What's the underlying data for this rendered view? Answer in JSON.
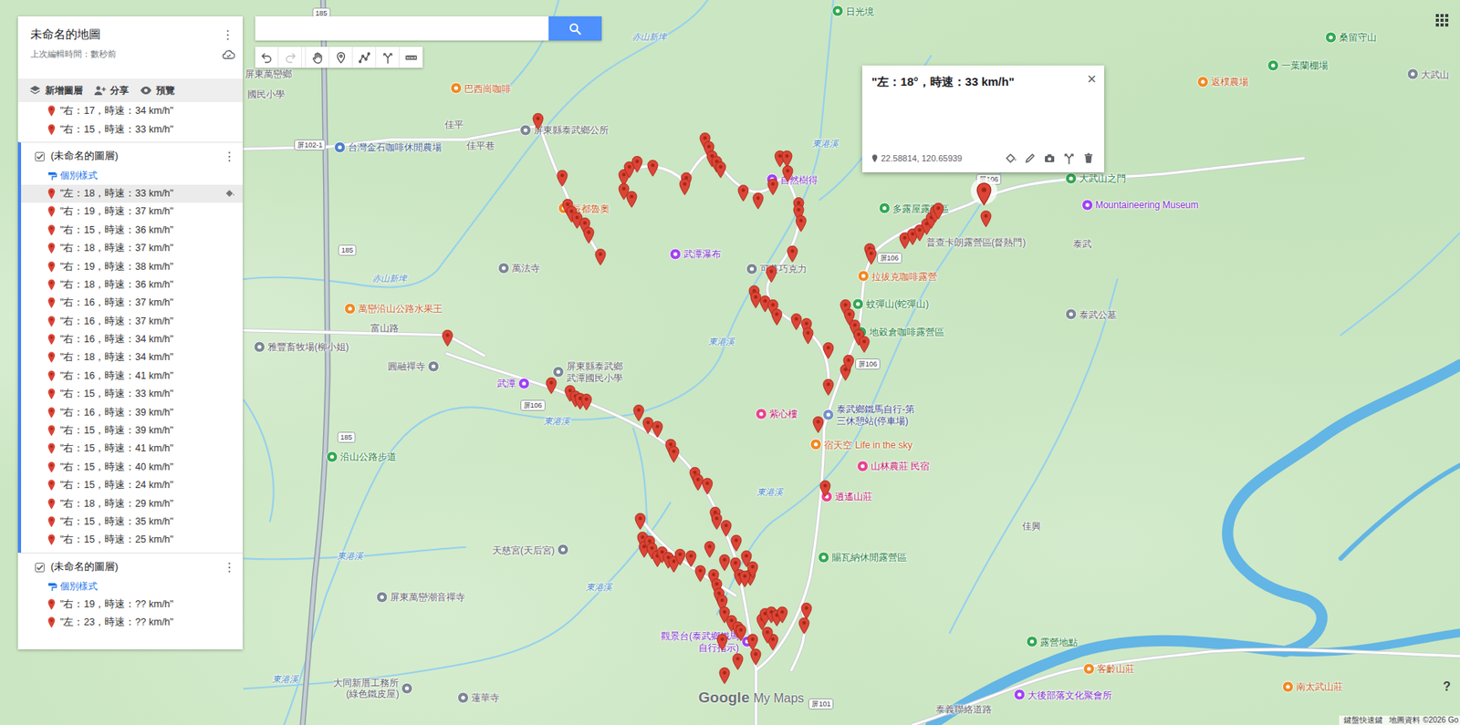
{
  "panel": {
    "title": "未命名的地圖",
    "subtitle": "上次編輯時間：數秒前",
    "menu": "⋮",
    "actions": [
      {
        "label": "新增圖層"
      },
      {
        "label": "分享"
      },
      {
        "label": "預覽"
      }
    ],
    "groups": [
      {
        "items": [
          {
            "label": "\"右：17，時速：34 km/h\"",
            "selected": false
          },
          {
            "label": "\"右：15，時速：33 km/h\"",
            "selected": false
          }
        ]
      },
      {
        "name": "(未命名的圖層)",
        "checked": true,
        "active": true,
        "menu": "⋮",
        "style_label": "個別樣式",
        "items": [
          {
            "label": "\"左：18，時速：33 km/h\"",
            "selected": true
          },
          {
            "label": "\"右：19，時速：37 km/h\"",
            "selected": false
          },
          {
            "label": "\"右：15，時速：36 km/h\"",
            "selected": false
          },
          {
            "label": "\"右：18，時速：37 km/h\"",
            "selected": false
          },
          {
            "label": "\"右：19，時速：38 km/h\"",
            "selected": false
          },
          {
            "label": "\"右：18，時速：36 km/h\"",
            "selected": false
          },
          {
            "label": "\"右：16，時速：37 km/h\"",
            "selected": false
          },
          {
            "label": "\"右：16，時速：37 km/h\"",
            "selected": false
          },
          {
            "label": "\"右：16，時速：34 km/h\"",
            "selected": false
          },
          {
            "label": "\"右：18，時速：34 km/h\"",
            "selected": false
          },
          {
            "label": "\"右：16，時速：41 km/h\"",
            "selected": false
          },
          {
            "label": "\"右：15，時速：33 km/h\"",
            "selected": false
          },
          {
            "label": "\"右：16，時速：39 km/h\"",
            "selected": false
          },
          {
            "label": "\"右：15，時速：39 km/h\"",
            "selected": false
          },
          {
            "label": "\"右：15，時速：41 km/h\"",
            "selected": false
          },
          {
            "label": "\"右：15，時速：40 km/h\"",
            "selected": false
          },
          {
            "label": "\"右：15，時速：24 km/h\"",
            "selected": false
          },
          {
            "label": "\"右：18，時速：29 km/h\"",
            "selected": false
          },
          {
            "label": "\"右：15，時速：35 km/h\"",
            "selected": false
          },
          {
            "label": "\"右：15，時速：25 km/h\"",
            "selected": false
          }
        ]
      },
      {
        "name": "(未命名的圖層)",
        "checked": true,
        "active": false,
        "menu": "⋮",
        "style_label": "個別樣式",
        "items": [
          {
            "label": "\"右：19，時速：?? km/h\"",
            "selected": false
          },
          {
            "label": "\"左：23，時速：?? km/h\"",
            "selected": false
          }
        ]
      }
    ]
  },
  "toolbar": [
    {
      "kind": "undo",
      "disabled": false
    },
    {
      "kind": "redo",
      "disabled": true
    },
    {
      "kind": "hand",
      "disabled": false
    },
    {
      "kind": "marker",
      "disabled": false
    },
    {
      "kind": "line",
      "disabled": false
    },
    {
      "kind": "route",
      "disabled": false
    },
    {
      "kind": "ruler",
      "disabled": false
    }
  ],
  "popup": {
    "title": "\"左：18°，時速：33 km/h\"",
    "coords": "22.58814, 120.65939",
    "close": "×"
  },
  "map": {
    "places": [
      {
        "text": "日光境",
        "kind": "park"
      },
      {
        "text": "桑留守山",
        "kind": "park"
      },
      {
        "text": "一葉蘭棚場",
        "kind": "park"
      },
      {
        "text": "大武山",
        "kind": "place"
      },
      {
        "text": "返樸農場",
        "kind": "food"
      },
      {
        "text": "巴西崗咖啡",
        "kind": "food"
      },
      {
        "text": "屏東縣泰武鄉公所",
        "kind": "place"
      },
      {
        "text": "佳平",
        "kind": "text"
      },
      {
        "text": "佳平巷",
        "kind": "text"
      },
      {
        "text": "台灣金石咖啡休閒農場",
        "kind": "shop"
      },
      {
        "text": "屏東萬巒鄉",
        "kind": "text"
      },
      {
        "text": "國民小學",
        "kind": "text"
      },
      {
        "text": "辰都魯奧",
        "kind": "food"
      },
      {
        "text": "自然樹得",
        "kind": "attraction"
      },
      {
        "text": "武潭瀑布",
        "kind": "attraction"
      },
      {
        "text": "萬法寺",
        "kind": "place"
      },
      {
        "text": "可蔓巧克力",
        "kind": "place"
      },
      {
        "text": "多露屋露營區",
        "kind": "park"
      },
      {
        "text": "普查卡朗露營區(督熱門)",
        "kind": "text"
      },
      {
        "text": "拉拔克咖啡露營",
        "kind": "food"
      },
      {
        "text": "蚊彈山(蛇彈山)",
        "kind": "park"
      },
      {
        "text": "地穀倉咖啡露營區",
        "kind": "park"
      },
      {
        "text": "大武山之門",
        "kind": "park"
      },
      {
        "text": "Mountaineering Museum",
        "kind": "attraction"
      },
      {
        "text": "泰武",
        "kind": "text"
      },
      {
        "text": "泰武公墓",
        "kind": "place"
      },
      {
        "text": "萬巒沿山公路水果王",
        "kind": "food"
      },
      {
        "text": "富山路",
        "kind": "text"
      },
      {
        "text": "雅豐畜牧場(柳小姐)",
        "kind": "place"
      },
      {
        "text": "圓融禪寺",
        "kind": "place"
      },
      {
        "text": "屏東縣泰武鄉武潭國民小學",
        "kind": "place"
      },
      {
        "text": "武潭",
        "kind": "attraction"
      },
      {
        "text": "紫心樓",
        "kind": "pink"
      },
      {
        "text": "泰武鄉鐵馬自行-第三休憩站(停車場)",
        "kind": "transit"
      },
      {
        "text": "宿天空 Life in the sky",
        "kind": "food"
      },
      {
        "text": "山林農莊 民宿",
        "kind": "pink"
      },
      {
        "text": "逍遙山莊",
        "kind": "pink"
      },
      {
        "text": "沿山公路步道",
        "kind": "park"
      },
      {
        "text": "佳興",
        "kind": "text"
      },
      {
        "text": "天慈宮(天后宮)",
        "kind": "place"
      },
      {
        "text": "賜瓦納休閒露營區",
        "kind": "park"
      },
      {
        "text": "屏東萬巒潮音禪寺",
        "kind": "place"
      },
      {
        "text": "觀景台(泰武鄉鐵馬自行指示)",
        "kind": "attraction"
      },
      {
        "text": "大同新厝工務所(綠色鐵皮屋)",
        "kind": "place"
      },
      {
        "text": "蓮華寺",
        "kind": "place"
      },
      {
        "text": "露營地點",
        "kind": "park"
      },
      {
        "text": "客齡山莊",
        "kind": "food"
      },
      {
        "text": "大後部落文化聚會所",
        "kind": "attraction"
      },
      {
        "text": "南太武山莊",
        "kind": "food"
      },
      {
        "text": "泰義聯絡道路",
        "kind": "text"
      },
      {
        "text": "東港溪",
        "kind": "water"
      },
      {
        "text": "東港溪",
        "kind": "water"
      },
      {
        "text": "東港溪",
        "kind": "water"
      },
      {
        "text": "東港溪",
        "kind": "water"
      },
      {
        "text": "東港溪",
        "kind": "water"
      },
      {
        "text": "東港溪",
        "kind": "water"
      },
      {
        "text": "東港溪",
        "kind": "water"
      },
      {
        "text": "赤山新埤",
        "kind": "water"
      },
      {
        "text": "赤山新埤",
        "kind": "water"
      },
      {
        "text": "185",
        "kind": "shield"
      },
      {
        "text": "185",
        "kind": "shield"
      },
      {
        "text": "185",
        "kind": "shield"
      },
      {
        "text": "屏102-1",
        "kind": "shield"
      },
      {
        "text": "屏106",
        "kind": "shield"
      },
      {
        "text": "屏106",
        "kind": "shield"
      },
      {
        "text": "屏106",
        "kind": "shield"
      },
      {
        "text": "屏106",
        "kind": "shield"
      },
      {
        "text": "屏101",
        "kind": "shield"
      }
    ],
    "logo": {
      "brand": "Google",
      "product": "My Maps"
    },
    "attribution": [
      "鍵盤快速鍵",
      "地圖資料 ©2026 Go"
    ],
    "help": "?"
  }
}
